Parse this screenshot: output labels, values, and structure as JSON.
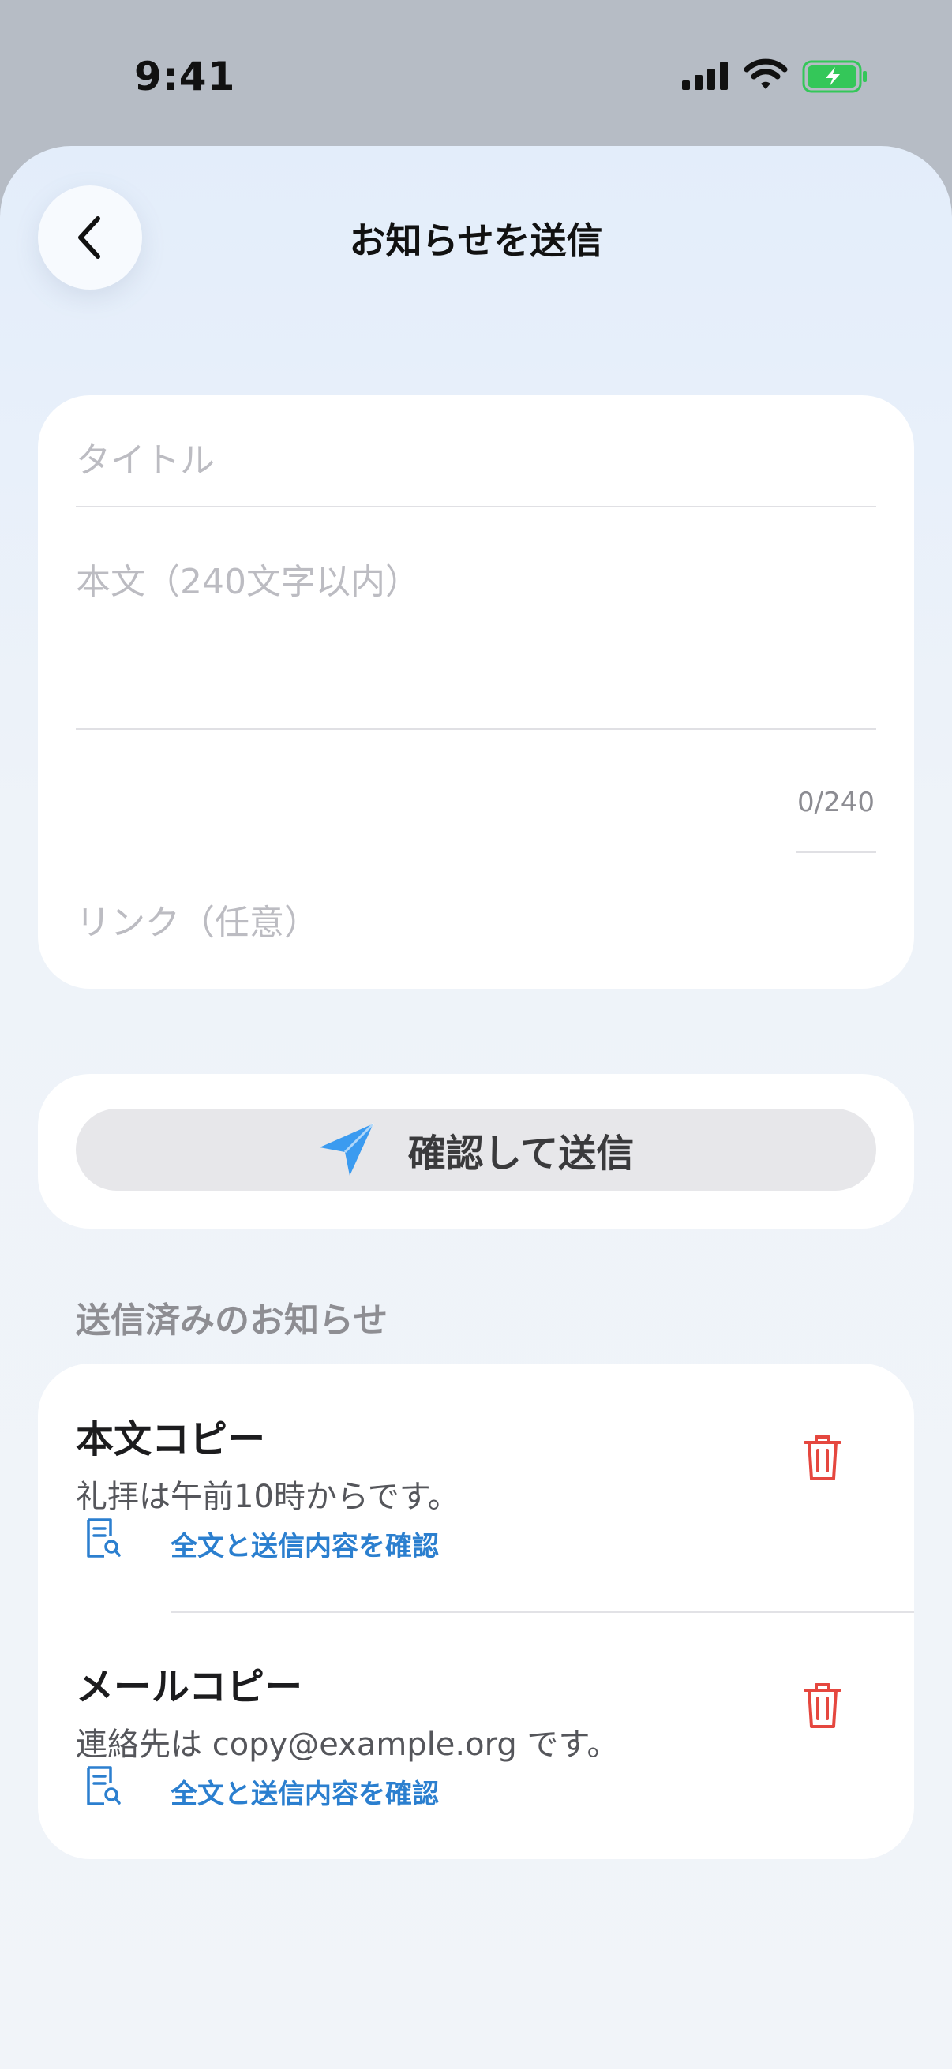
{
  "status_bar": {
    "time": "9:41"
  },
  "header": {
    "title": "お知らせを送信"
  },
  "form": {
    "title_placeholder": "タイトル",
    "body_placeholder": "本文（240文字以内）",
    "counter": "0/240",
    "link_placeholder": "リンク（任意）"
  },
  "send_button": {
    "label": "確認して送信"
  },
  "sent_section": {
    "title": "送信済みのお知らせ",
    "items": [
      {
        "title": "本文コピー",
        "body": "礼拝は午前10時からです。",
        "link": "全文と送信内容を確認"
      },
      {
        "title": "メールコピー",
        "body": "連絡先は copy@example.org です。",
        "link": "全文と送信内容を確認"
      }
    ]
  },
  "colors": {
    "accent": "#2b7fcf",
    "send_icon": "#3b9bf0",
    "delete": "#e5473f",
    "battery": "#34c759"
  }
}
